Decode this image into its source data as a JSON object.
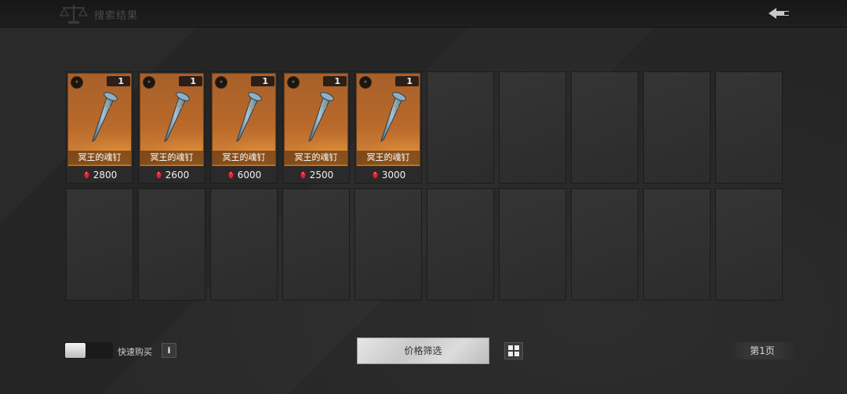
{
  "header": {
    "title": "搜索结果",
    "scale_icon": "balance-scale-icon",
    "back_icon": "back-arrow-icon"
  },
  "items": [
    {
      "name": "冥王的魂钉",
      "qty": "1",
      "price": "2800"
    },
    {
      "name": "冥王的魂钉",
      "qty": "1",
      "price": "2600"
    },
    {
      "name": "冥王的魂钉",
      "qty": "1",
      "price": "6000"
    },
    {
      "name": "冥王的魂钉",
      "qty": "1",
      "price": "2500"
    },
    {
      "name": "冥王的魂钉",
      "qty": "1",
      "price": "3000"
    }
  ],
  "empty_slot_count": 15,
  "footer": {
    "quick_buy_label": "快速购买",
    "quick_buy_on": false,
    "info_label": "i",
    "price_filter_label": "价格筛选",
    "page_label": "第1页"
  },
  "colors": {
    "card_orange": "#b8692a",
    "currency_red": "#d8283a",
    "background": "#252525"
  }
}
